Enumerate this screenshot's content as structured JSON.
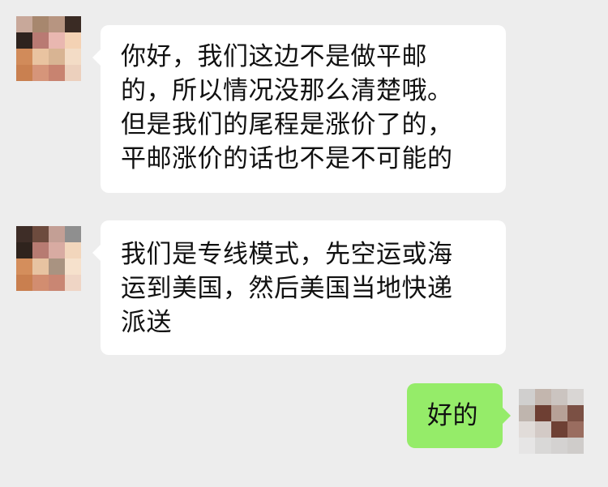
{
  "chat": {
    "messages": [
      {
        "sender": "contact",
        "lines": [
          "你好，我们这边不是做平邮",
          "的，所以情况没那么清楚哦。",
          "但是我们的尾程是涨价了的，",
          "平邮涨价的话也不是不可能的"
        ]
      },
      {
        "sender": "contact",
        "lines": [
          "我们是专线模式，先空运或海",
          "运到美国，然后美国当地快递",
          "派送"
        ]
      },
      {
        "sender": "me",
        "lines": [
          "好的"
        ]
      }
    ]
  },
  "colors": {
    "background": "#ededed",
    "incoming_bubble": "#ffffff",
    "outgoing_bubble": "#95ec69",
    "text": "#111111"
  },
  "icons": {
    "contact_avatar": "pixelated-avatar",
    "my_avatar": "pixelated-avatar"
  }
}
